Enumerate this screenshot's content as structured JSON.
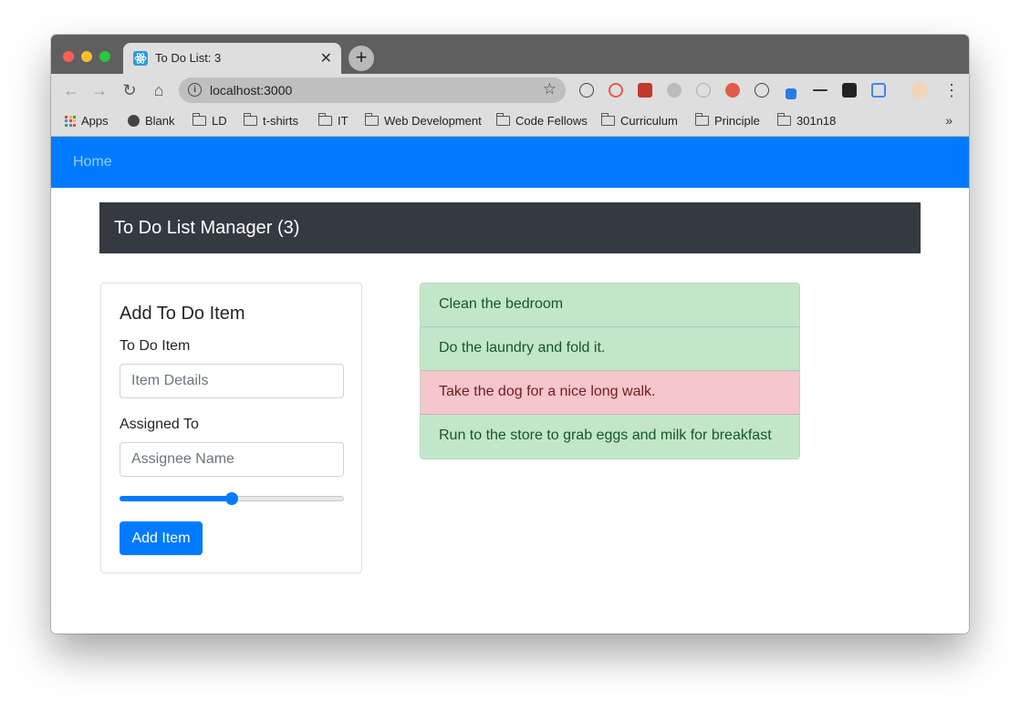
{
  "browser": {
    "tab_title": "To Do List: 3",
    "tab_close": "✕",
    "new_tab": "+",
    "url": "localhost:3000",
    "bookmarks": [
      {
        "label": "Apps",
        "icon": "apps-grid-icon"
      },
      {
        "label": "Blank",
        "icon": "globe-icon"
      },
      {
        "label": "LD",
        "icon": "folder-icon"
      },
      {
        "label": "t-shirts",
        "icon": "folder-icon"
      },
      {
        "label": "IT",
        "icon": "folder-icon"
      },
      {
        "label": "Web Development",
        "icon": "folder-icon"
      },
      {
        "label": "Code Fellows",
        "icon": "folder-icon"
      },
      {
        "label": "Curriculum",
        "icon": "folder-icon"
      },
      {
        "label": "Principle",
        "icon": "folder-icon"
      },
      {
        "label": "301n18",
        "icon": "folder-icon"
      }
    ],
    "more": "»"
  },
  "navbar": {
    "home": "Home"
  },
  "header": {
    "title": "To Do List Manager (3)"
  },
  "form": {
    "title": "Add To Do Item",
    "item_label": "To Do Item",
    "item_placeholder": "Item Details",
    "assignee_label": "Assigned To",
    "assignee_placeholder": "Assignee Name",
    "difficulty_level": 0.5,
    "submit": "Add Item"
  },
  "todos": [
    {
      "text": "Clean the bedroom",
      "status": "complete"
    },
    {
      "text": "Do the laundry and fold it.",
      "status": "complete"
    },
    {
      "text": "Take the dog for a nice long walk.",
      "status": "incomplete"
    },
    {
      "text": "Run to the store to grab eggs and milk for breakfast",
      "status": "complete"
    }
  ],
  "colors": {
    "primary": "#007bff",
    "header_bg": "#343a40",
    "complete_bg": "#c3e6cb",
    "incomplete_bg": "#f5c6cb"
  }
}
